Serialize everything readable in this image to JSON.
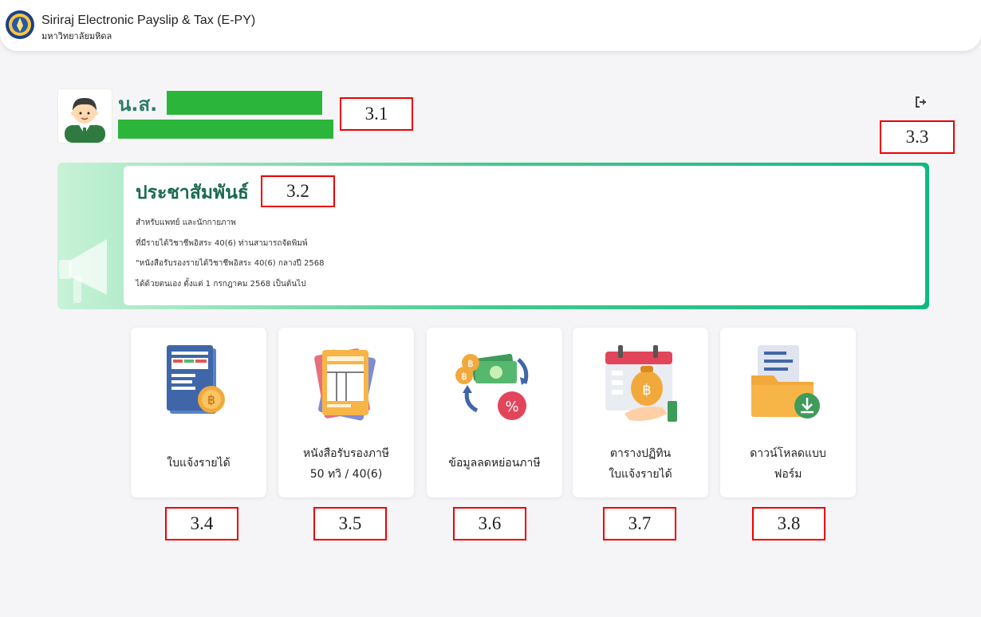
{
  "header": {
    "title": "Siriraj Electronic Payslip & Tax (E-PY)",
    "subtitle": "มหาวิทยาลัยมหิดล",
    "logo_icon": "university-seal-icon"
  },
  "user": {
    "prefix": "น.ส.",
    "avatar_icon": "user-avatar-icon",
    "logout_icon": "logout-icon"
  },
  "annotations": [
    "3.1",
    "3.2",
    "3.3",
    "3.4",
    "3.5",
    "3.6",
    "3.7",
    "3.8"
  ],
  "announcement": {
    "title": "ประชาสัมพันธ์",
    "icon": "megaphone-icon",
    "lines": [
      "สำหรับแพทย์ และนักกายภาพ",
      "ที่มีรายได้วิชาชีพอิสระ 40(6) ท่านสามารถจัดพิมพ์",
      "\"หนังสือรับรองรายได้วิชาชีพอิสระ 40(6) กลางปี 2568",
      "ได้ด้วยตนเอง ตั้งแต่ 1 กรกฎาคม 2568 เป็นต้นไป"
    ]
  },
  "menu": [
    {
      "line1": "ใบแจ้งรายได้",
      "line2": "",
      "icon": "payslip-icon"
    },
    {
      "line1": "หนังสือรับรองภาษี",
      "line2": "50 ทวิ / 40(6)",
      "icon": "tax-certificate-icon"
    },
    {
      "line1": "ข้อมูลลดหย่อนภาษี",
      "line2": "",
      "icon": "tax-deduction-icon"
    },
    {
      "line1": "ตารางปฏิทิน",
      "line2": "ใบแจ้งรายได้",
      "icon": "calendar-payday-icon"
    },
    {
      "line1": "ดาวน์โหลดแบบ",
      "line2": "ฟอร์ม",
      "icon": "download-form-icon"
    }
  ],
  "colors": {
    "accent": "#2d7f6a",
    "annotation": "#e00000",
    "mask": "#2bb53a"
  }
}
